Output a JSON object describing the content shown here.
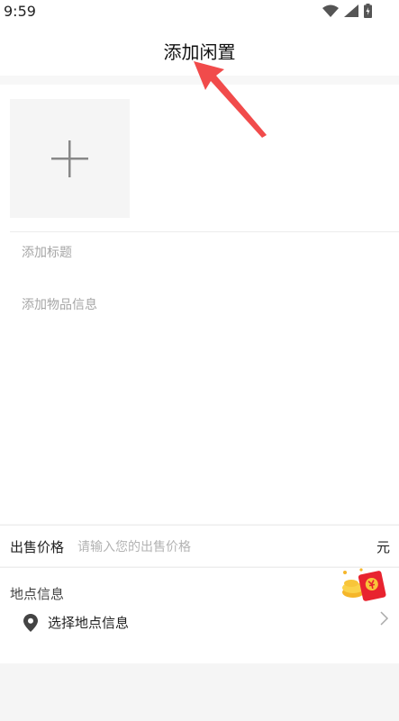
{
  "status_bar": {
    "time": "9:59"
  },
  "header": {
    "title": "添加闲置"
  },
  "form": {
    "add_photo_icon": "plus-icon",
    "title_placeholder": "添加标题",
    "description_placeholder": "添加物品信息"
  },
  "price": {
    "label": "出售价格",
    "placeholder": "请输入您的出售价格",
    "unit": "元"
  },
  "location": {
    "section_title": "地点信息",
    "select_label": "选择地点信息"
  },
  "colors": {
    "annotation_arrow": "#f14b4b",
    "red_packet": "#e8232f"
  }
}
